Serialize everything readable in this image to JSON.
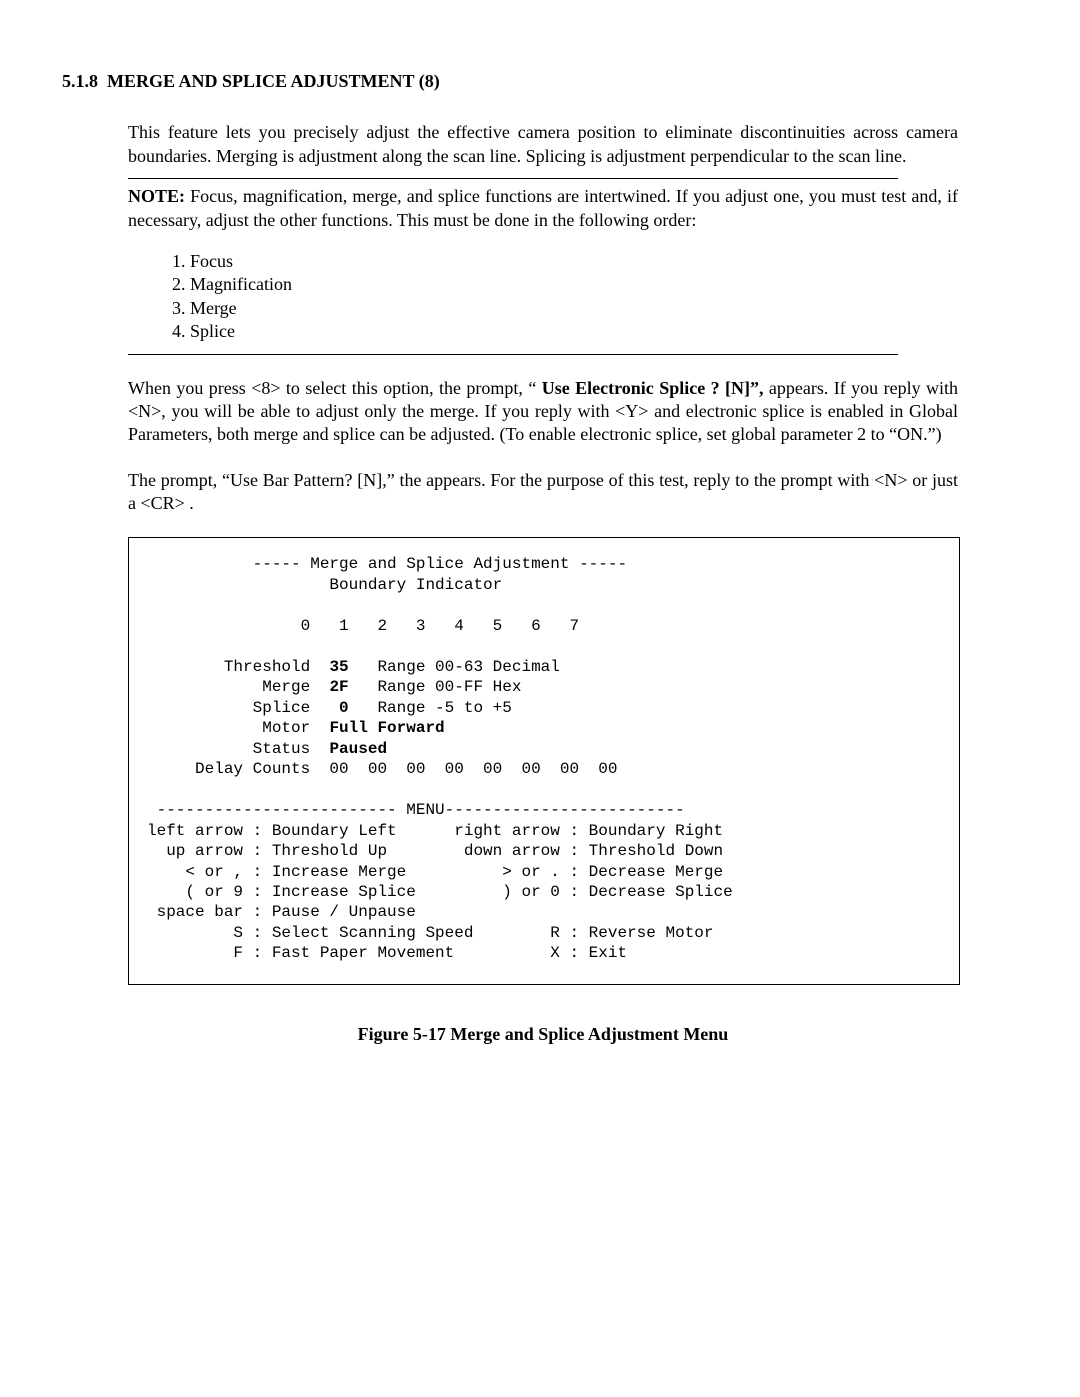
{
  "heading": {
    "number": "5.1.8",
    "title": "MERGE AND  SPLICE  ADJUSTMENT  (8)"
  },
  "intro_para": "This feature lets you precisely  adjust the effective camera position to eliminate discontinuities across camera boundaries. Merging is adjustment along the scan line. Splicing is adjustment perpendicular to the scan line.",
  "note": {
    "label": "NOTE:",
    "text": "  Focus, magnification, merge, and splice functions are intertwined.  If you adjust one, you must test and, if necessary, adjust the other functions. This must be done in the following order:"
  },
  "order_list": [
    "1. Focus",
    "2. Magnification",
    "3. Merge",
    "4. Splice"
  ],
  "para_after_note_1a": "When you press <8> to select this option, the prompt, “ ",
  "para_after_note_1_bold": "Use Electronic Splice ? [N]”,",
  "para_after_note_1b": " appears. If you reply with <N>, you will be able to adjust only the merge.  If you reply with <Y> and electronic splice is enabled in Global  Parameters, both merge and splice can be adjusted.  (To enable electronic splice, set global parameter 2 to “ON.”)",
  "para_after_note_2": "The prompt, “Use Bar Pattern? [N],” the appears.  For the purpose of this test, reply to the prompt with <N> or just a <CR> .",
  "terminal": {
    "title_line": "           ----- Merge and Splice Adjustment -----",
    "sub_line": "                   Boundary Indicator",
    "indices_line": "                0   1   2   3   4   5   6   7",
    "threshold": {
      "label": "        Threshold  ",
      "value": "35",
      "range": "   Range 00-63 Decimal"
    },
    "merge": {
      "label": "            Merge  ",
      "value": "2F",
      "range": "   Range 00-FF Hex"
    },
    "splice": {
      "label": "           Splice   ",
      "value": "0",
      "range": "   Range -5 to +5"
    },
    "motor": {
      "label": "            Motor  ",
      "value": "Full Forward"
    },
    "status": {
      "label": "           Status  ",
      "value": "Paused"
    },
    "delay_line": "     Delay Counts  00  00  00  00  00  00  00  00",
    "menu_rule": " ------------------------- MENU-------------------------",
    "menu_lines": [
      "left arrow : Boundary Left      right arrow : Boundary Right",
      "  up arrow : Threshold Up        down arrow : Threshold Down",
      "    < or , : Increase Merge          > or . : Decrease Merge",
      "    ( or 9 : Increase Splice         ) or 0 : Decrease Splice",
      " space bar : Pause / Unpause",
      "         S : Select Scanning Speed        R : Reverse Motor",
      "         F : Fast Paper Movement          X : Exit"
    ]
  },
  "figure_caption": "Figure 5-17  Merge and Splice Adjustment Menu"
}
